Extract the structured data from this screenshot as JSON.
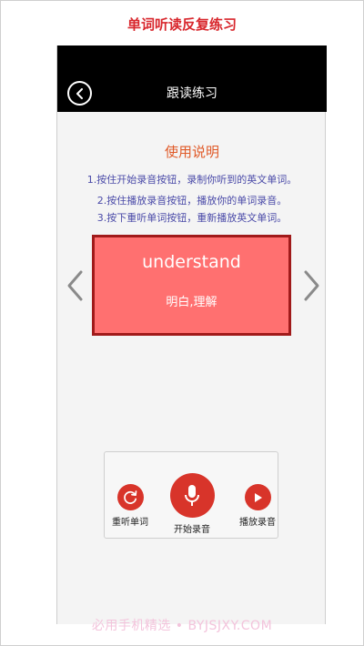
{
  "caption": "单词听读反复练习",
  "topbar": {
    "title": "跟读练习"
  },
  "help": {
    "title": "使用说明",
    "lines": [
      "1.按住开始录音按钮，录制你听到的英文单词。",
      "2.按住播放录音按钮，播放你的单词录音。",
      "3.按下重听单词按钮，重新播放英文单词。"
    ]
  },
  "card": {
    "word": "understand",
    "meaning": "明白,理解"
  },
  "controls": {
    "replay_label": "重听单词",
    "record_label": "开始录音",
    "play_label": "播放录音"
  },
  "colors": {
    "caption": "#d8262c",
    "card_fill": "#ff7070",
    "card_border": "#a01a1a",
    "button_red": "#d8342a",
    "help_title": "#e05a28",
    "help_text": "#4a4aa8"
  },
  "icons": [
    "back-icon",
    "chevron-left-icon",
    "chevron-right-icon",
    "replay-icon",
    "microphone-icon",
    "play-icon"
  ],
  "watermark": "必用手机精选 • BYJSJXY.COM"
}
